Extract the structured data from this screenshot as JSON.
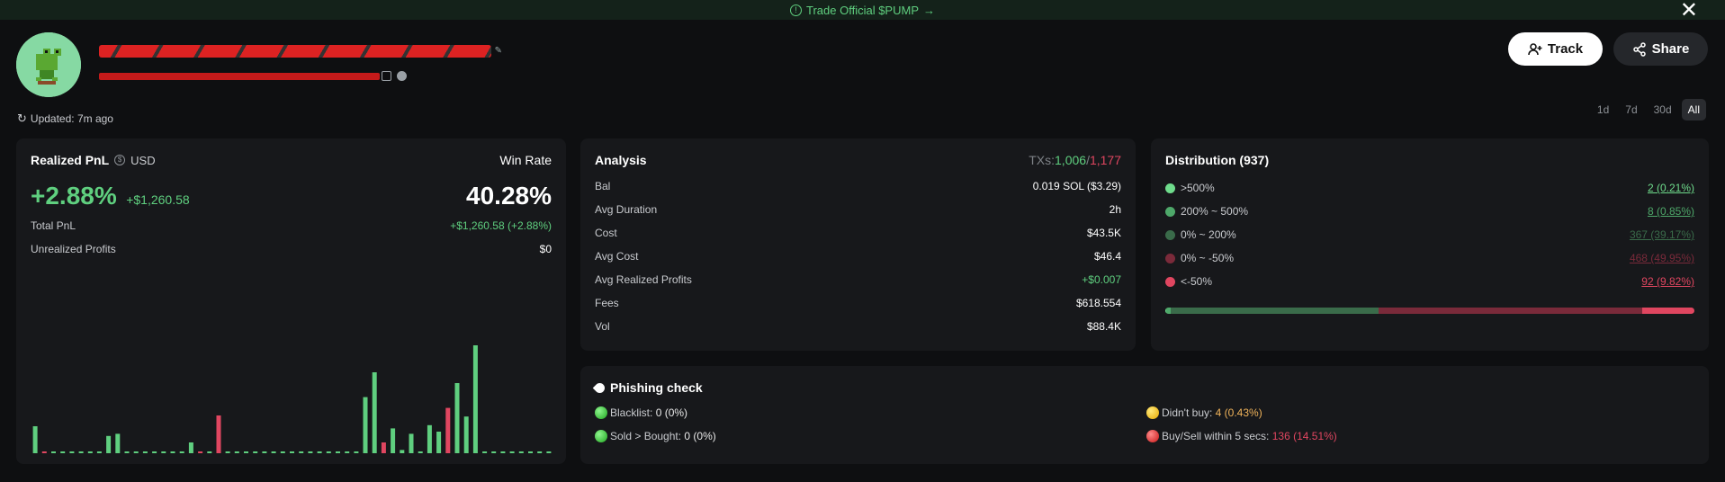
{
  "banner": {
    "text": "Trade Official $PUMP",
    "icon": "info-circle-icon",
    "arrow": "→"
  },
  "header": {
    "close": "✕",
    "track_label": "Track",
    "share_label": "Share",
    "updated": "Updated: 7m ago"
  },
  "periods": [
    "1d",
    "7d",
    "30d",
    "All"
  ],
  "active_period": "All",
  "pnl": {
    "title": "Realized PnL",
    "currency": "USD",
    "winrate_label": "Win Rate",
    "percent": "+2.88%",
    "amount": "+$1,260.58",
    "winrate": "40.28%",
    "rows": [
      {
        "label": "Total PnL",
        "value": "+$1,260.58 (+2.88%)"
      },
      {
        "label": "Unrealized Profits",
        "value": "$0"
      }
    ],
    "bars": [
      0.25,
      0.01,
      0.01,
      0.01,
      0.01,
      0.01,
      0.01,
      0.01,
      0.16,
      0.18,
      0.01,
      0.01,
      0.01,
      0.01,
      0.01,
      0.01,
      0.01,
      0.1,
      0.01,
      0.01,
      0.35,
      0.01,
      0.01,
      0.01,
      0.01,
      0.01,
      0.01,
      0.01,
      0.01,
      0.01,
      0.01,
      0.01,
      0.01,
      0.01,
      0.01,
      0.01,
      0.52,
      0.75,
      0.1,
      0.23,
      0.03,
      0.18,
      0.01,
      0.26,
      0.2,
      0.42,
      0.65,
      0.34,
      1.0,
      0.01,
      0.01,
      0.01,
      0.01,
      0.01,
      0.01,
      0.01,
      0.01
    ],
    "bar_neg": [
      0,
      1,
      0,
      0,
      0,
      0,
      0,
      0,
      0,
      0,
      0,
      0,
      0,
      0,
      0,
      0,
      0,
      0,
      1,
      0,
      1,
      0,
      0,
      0,
      0,
      0,
      0,
      0,
      0,
      0,
      0,
      0,
      0,
      0,
      0,
      0,
      0,
      0,
      1,
      0,
      0,
      0,
      0,
      0,
      0,
      1,
      0,
      0,
      0,
      0,
      0,
      0,
      0,
      0,
      0,
      0,
      0
    ]
  },
  "analysis": {
    "title": "Analysis",
    "txs_label": "TXs:",
    "txs_buys": "1,006",
    "txs_sep": "/",
    "txs_sells": "1,177",
    "rows": [
      {
        "label": "Bal",
        "value": "0.019 SOL ($3.29)"
      },
      {
        "label": "Avg Duration",
        "value": "2h"
      },
      {
        "label": "Cost",
        "value": "$43.5K"
      },
      {
        "label": "Avg Cost",
        "value": "$46.4"
      },
      {
        "label": "Avg Realized Profits",
        "value": "+$0.007"
      },
      {
        "label": "Fees",
        "value": "$618.554"
      },
      {
        "label": "Vol",
        "value": "$88.4K"
      }
    ]
  },
  "distribution": {
    "title": "Distribution (937)",
    "rows": [
      {
        "label": ">500%",
        "value": "2 (0.21%)",
        "color": "#6fdc8c",
        "fraction": 0.0021
      },
      {
        "label": "200% ~ 500%",
        "value": "8 (0.85%)",
        "color": "#4ea86a",
        "fraction": 0.0085
      },
      {
        "label": "0% ~ 200%",
        "value": "367 (39.17%)",
        "color": "#3a6b4a",
        "fraction": 0.3917
      },
      {
        "label": "0% ~ -50%",
        "value": "468 (49.95%)",
        "color": "#7a2a3a",
        "fraction": 0.4995
      },
      {
        "label": "<-50%",
        "value": "92 (9.82%)",
        "color": "#e04660",
        "fraction": 0.0982
      }
    ]
  },
  "phishing": {
    "title": "Phishing check",
    "items": [
      {
        "label": "Blacklist:",
        "value": "0 (0%)",
        "status": "green"
      },
      {
        "label": "Didn't buy:",
        "value": "4 (0.43%)",
        "status": "yellow"
      },
      {
        "label": "Sold > Bought:",
        "value": "0 (0%)",
        "status": "green"
      },
      {
        "label": "Buy/Sell within 5 secs:",
        "value": "136 (14.51%)",
        "status": "red"
      }
    ]
  },
  "colors": {
    "accent_green": "#5fcf7f",
    "accent_red": "#e04660",
    "card_bg": "#17181b",
    "page_bg": "#0e0f11"
  }
}
